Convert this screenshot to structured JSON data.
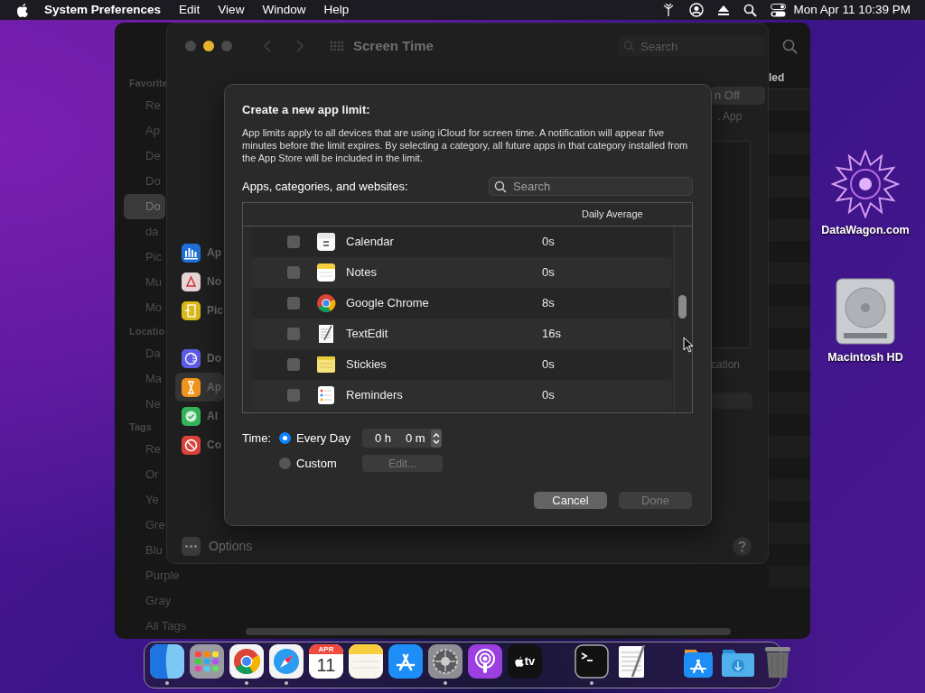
{
  "menu_bar": {
    "app_name": "System Preferences",
    "menus": [
      "Edit",
      "View",
      "Window",
      "Help"
    ],
    "clock": "Mon Apr 11  10:39 PM"
  },
  "finder_window": {
    "sections": [
      {
        "heading": "Favorite",
        "items": [
          {
            "label": "Re",
            "selected": false
          },
          {
            "label": "Ap",
            "selected": false
          },
          {
            "label": "De",
            "selected": false
          },
          {
            "label": "Do",
            "selected": false
          },
          {
            "label": "Do",
            "selected": true
          },
          {
            "label": "da",
            "selected": false
          },
          {
            "label": "Pic",
            "selected": false
          },
          {
            "label": "Mu",
            "selected": false
          },
          {
            "label": "Mo",
            "selected": false
          }
        ]
      },
      {
        "heading": "Locatio",
        "items": [
          {
            "label": "Da",
            "selected": false
          },
          {
            "label": "Ma",
            "selected": false
          },
          {
            "label": "Ne",
            "selected": false
          }
        ]
      },
      {
        "heading": "Tags",
        "items": [
          {
            "label": "Re",
            "selected": false
          },
          {
            "label": "Or",
            "selected": false
          },
          {
            "label": "Ye",
            "selected": false
          },
          {
            "label": "Gre",
            "selected": false
          },
          {
            "label": "Blu",
            "selected": false
          },
          {
            "label": "Purple",
            "selected": false
          },
          {
            "label": "Gray",
            "selected": false
          },
          {
            "label": "All Tags",
            "selected": false
          }
        ]
      }
    ],
    "column_header": "led"
  },
  "screen_time_window": {
    "title": "Screen Time",
    "search_placeholder": "Search",
    "sidebar_groups": [
      [
        {
          "label": "Ap",
          "kind": "chart",
          "color": "#1f6fd8",
          "selected": false
        },
        {
          "label": "No",
          "kind": "bell",
          "color": "#e6d5d5",
          "selected": false
        },
        {
          "label": "Pic",
          "kind": "pickup",
          "color": "#d9b91c",
          "selected": false
        }
      ],
      [
        {
          "label": "Do",
          "kind": "downtime",
          "color": "#5e5ce6",
          "selected": false
        },
        {
          "label": "Ap",
          "kind": "hourglass",
          "color": "#f0941e",
          "selected": true
        },
        {
          "label": "Al",
          "kind": "check",
          "color": "#34b45a",
          "selected": false
        },
        {
          "label": "Co",
          "kind": "block",
          "color": "#d9443a",
          "selected": false
        }
      ]
    ],
    "options": "Options",
    "pane_texts": {
      "toggle_button": "n Off",
      "caption": ". App",
      "footer": "cation"
    }
  },
  "dialog": {
    "title": "Create a new app limit:",
    "description": "App limits apply to all devices that are using iCloud for screen time. A notification will appear five minutes before the limit expires. By selecting a category, all future apps in that category installed from the App Store will be included in the limit.",
    "list_label": "Apps, categories, and websites:",
    "search_placeholder": "Search",
    "column_header": "Daily Average",
    "apps": [
      {
        "name": "Calendar",
        "kind": "calendar",
        "average": "0s",
        "checked": false
      },
      {
        "name": "Notes",
        "kind": "notes",
        "average": "0s",
        "checked": false
      },
      {
        "name": "Google Chrome",
        "kind": "chrome",
        "average": "8s",
        "checked": false
      },
      {
        "name": "TextEdit",
        "kind": "textedit",
        "average": "16s",
        "checked": false
      },
      {
        "name": "Stickies",
        "kind": "stickies",
        "average": "0s",
        "checked": false
      },
      {
        "name": "Reminders",
        "kind": "reminders",
        "average": "0s",
        "checked": false
      }
    ],
    "time_label": "Time:",
    "schedule_options": [
      {
        "label": "Every Day",
        "selected": true
      },
      {
        "label": "Custom",
        "selected": false
      }
    ],
    "hours": "0 h",
    "minutes": "0 m",
    "edit_button": {
      "label": "Edit...",
      "disabled": true
    },
    "buttons": [
      {
        "label": "Cancel",
        "disabled": false
      },
      {
        "label": "Done",
        "disabled": true
      }
    ]
  },
  "desktop_icons": [
    {
      "label": "DataWagon.com",
      "kind": "star"
    },
    {
      "label": "Macintosh HD",
      "kind": "disk"
    }
  ],
  "dock": {
    "items": [
      {
        "kind": "finder",
        "running": true
      },
      {
        "kind": "launchpad"
      },
      {
        "kind": "chrome",
        "running": true
      },
      {
        "kind": "safari",
        "running": true
      },
      {
        "kind": "calendar",
        "month": "APR",
        "day": "11"
      },
      {
        "kind": "notes"
      },
      {
        "kind": "appstore"
      },
      {
        "kind": "settings",
        "running": true
      },
      {
        "kind": "podcasts"
      },
      {
        "kind": "tv",
        "label": "tv"
      },
      {
        "kind": "separator"
      },
      {
        "kind": "terminal",
        "running": true
      },
      {
        "kind": "textedit"
      },
      {
        "kind": "separator"
      },
      {
        "kind": "appstore_folder"
      },
      {
        "kind": "downloads"
      },
      {
        "kind": "trash"
      }
    ]
  }
}
